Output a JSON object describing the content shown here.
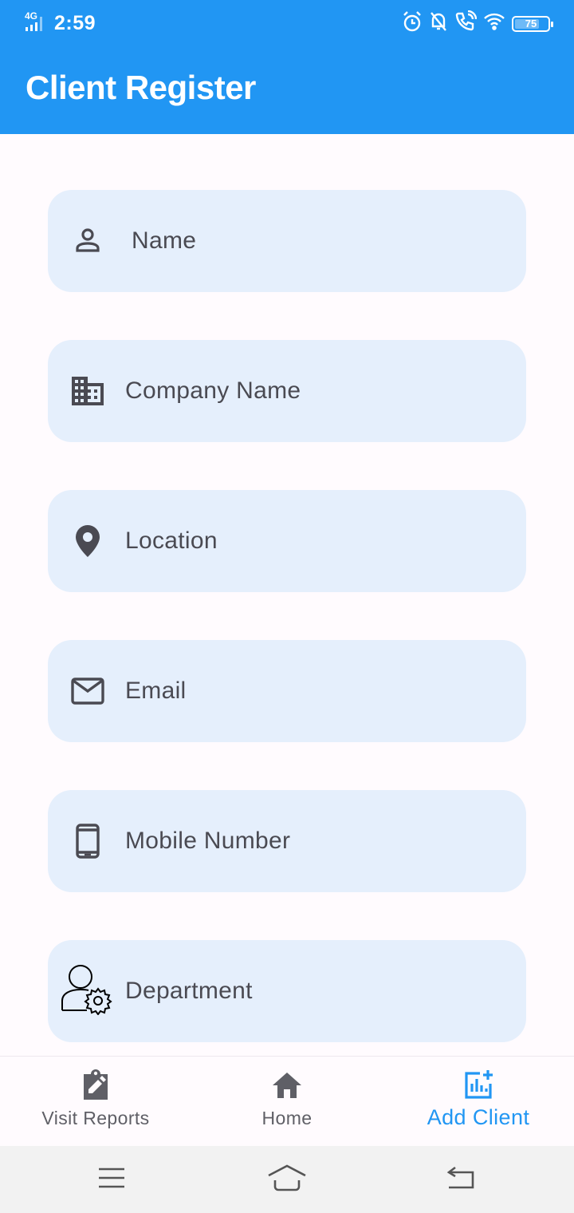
{
  "status_bar": {
    "network": "4G",
    "time": "2:59",
    "battery_percent": 75,
    "battery_label": "75"
  },
  "app_bar": {
    "title": "Client Register"
  },
  "form": {
    "fields": [
      {
        "placeholder": "Name",
        "icon": "person-outline-icon"
      },
      {
        "placeholder": "Company Name",
        "icon": "business-icon"
      },
      {
        "placeholder": "Location",
        "icon": "location-pin-icon"
      },
      {
        "placeholder": "Email",
        "icon": "mail-outline-icon"
      },
      {
        "placeholder": "Mobile Number",
        "icon": "smartphone-icon"
      },
      {
        "placeholder": "Department",
        "icon": "user-settings-icon"
      }
    ]
  },
  "bottom_nav": {
    "items": [
      {
        "label": "Visit Reports",
        "icon": "assignment-edit-icon",
        "active": false
      },
      {
        "label": "Home",
        "icon": "home-icon",
        "active": false
      },
      {
        "label": "Add Client",
        "icon": "add-chart-icon",
        "active": true
      }
    ]
  },
  "colors": {
    "primary": "#2196f3",
    "field_bg": "#e5effc",
    "page_bg": "#fffbfe",
    "icon": "#4a4a52",
    "nav_inactive": "#5f5f66",
    "system_nav_bg": "#f2f2f2"
  }
}
